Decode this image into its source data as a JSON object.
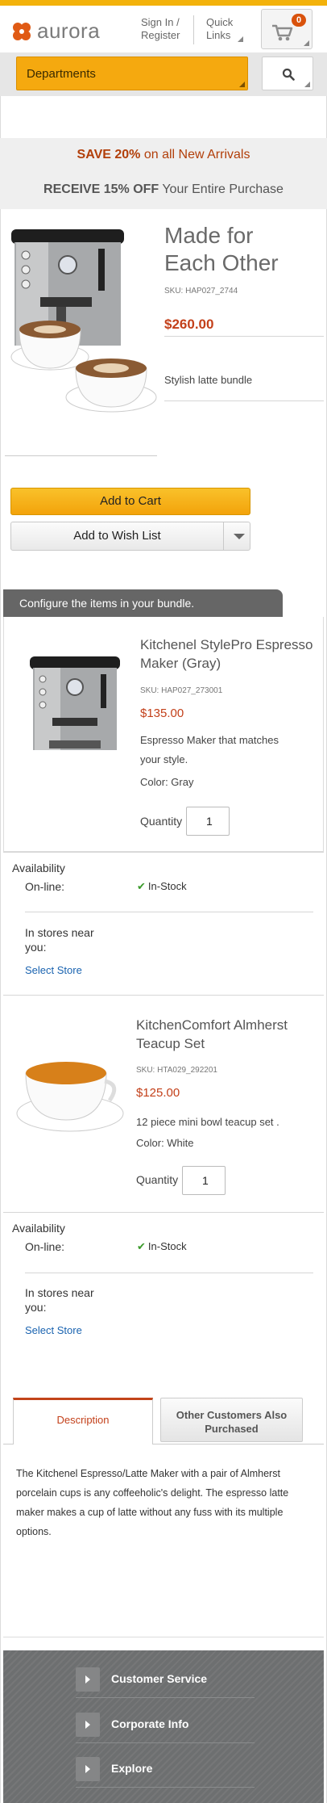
{
  "header": {
    "logo_text": "aurora",
    "signin_line1": "Sign In /",
    "signin_line2": "Register",
    "quick_line1": "Quick",
    "quick_line2": "Links",
    "cart_count": "0"
  },
  "departments": {
    "label": "Departments"
  },
  "promo": {
    "line1_bold": "SAVE 20%",
    "line1_rest": " on all New Arrivals",
    "line2_bold": "RECEIVE 15% OFF",
    "line2_rest": " Your Entire Purchase"
  },
  "product": {
    "title_line1": "Made for",
    "title_line2": "Each Other",
    "sku": "SKU: HAP027_2744",
    "price": "$260.00",
    "description": "Stylish latte bundle",
    "add_to_cart": "Add to Cart",
    "add_to_wishlist": "Add to Wish List"
  },
  "bundle": {
    "header": "Configure the items in your bundle.",
    "items": [
      {
        "title_line1": "Kitchenel StylePro Espresso",
        "title_line2": "Maker (Gray)",
        "sku": "SKU: HAP027_273001",
        "price": "$135.00",
        "desc_line1": "Espresso Maker that matches",
        "desc_line2": "your style.",
        "color": "Color: Gray",
        "quantity_label": "Quantity",
        "quantity": "1",
        "availability": "Availability",
        "online_label": "On-line:",
        "online_status": "In-Stock",
        "stores_line1": "In stores near",
        "stores_line2": "you:",
        "select_store": "Select Store"
      },
      {
        "title_line1": "KitchenComfort Almherst",
        "title_line2": "Teacup Set",
        "sku": "SKU: HTA029_292201",
        "price": "$125.00",
        "desc_line1": "12 piece mini bowl teacup set .",
        "color": "Color: White",
        "quantity_label": "Quantity",
        "quantity": "1",
        "availability": "Availability",
        "online_label": "On-line:",
        "online_status": "In-Stock",
        "stores_line1": "In stores near",
        "stores_line2": "you:",
        "select_store": "Select Store"
      }
    ]
  },
  "tabs": {
    "description": "Description",
    "other_line1": "Other Customers Also",
    "other_line2": "Purchased"
  },
  "description_text": "The Kitchenel Espresso/Latte Maker with a pair of Almherst porcelain cups is any coffeeholic's delight. The espresso latte maker makes a cup of latte without any fuss with its multiple options.",
  "footer": {
    "items": [
      "Customer Service",
      "Corporate Info",
      "Explore"
    ]
  },
  "colors": {
    "accent_orange": "#f3a30b",
    "price_red": "#c3401a",
    "footer_gray": "#6d6f70",
    "link_blue": "#1a63b0"
  }
}
